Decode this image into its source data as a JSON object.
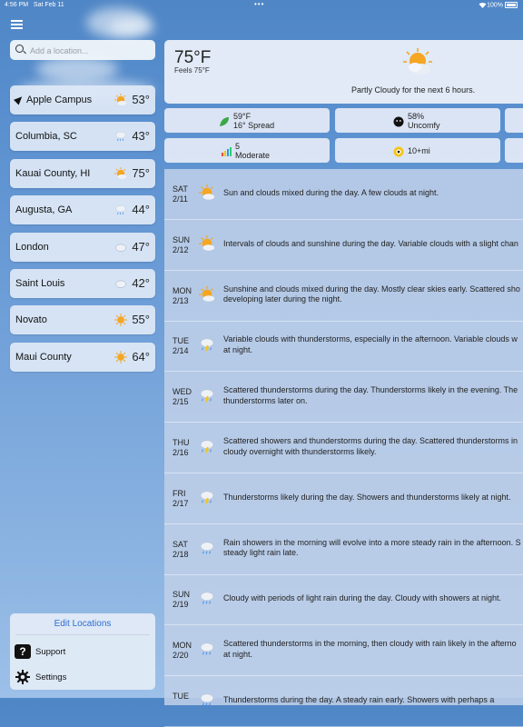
{
  "status_bar": {
    "time": "4:56 PM",
    "date": "Sat Feb 11",
    "battery": "100%"
  },
  "search": {
    "placeholder": "Add a location..."
  },
  "locations": [
    {
      "name": "Apple Campus",
      "temp": "53°",
      "icon": "partly-cloudy-icon",
      "active": true
    },
    {
      "name": "Columbia, SC",
      "temp": "43°",
      "icon": "rain-icon"
    },
    {
      "name": "Kauai County, HI",
      "temp": "75°",
      "icon": "partly-cloudy-icon"
    },
    {
      "name": "Augusta, GA",
      "temp": "44°",
      "icon": "rain-icon"
    },
    {
      "name": "London",
      "temp": "47°",
      "icon": "cloudy-icon"
    },
    {
      "name": "Saint Louis",
      "temp": "42°",
      "icon": "cloudy-icon"
    },
    {
      "name": "Novato",
      "temp": "55°",
      "icon": "sunny-icon"
    },
    {
      "name": "Maui County",
      "temp": "64°",
      "icon": "sunny-icon"
    }
  ],
  "bottom_panel": {
    "edit_locations": "Edit Locations",
    "support": "Support",
    "settings": "Settings"
  },
  "current": {
    "temp": "75°F",
    "feels_like": "Feels 75°F",
    "condition": "Partly Cloudy for the next 6 hours.",
    "icon": "partly-cloudy-icon"
  },
  "tiles": [
    {
      "icon": "leaf-icon",
      "line1": "59°F",
      "line2": "16° Spread"
    },
    {
      "icon": "dewpoint-face-icon",
      "line1": "58%",
      "line2": "Uncomfy"
    },
    {
      "icon": "uv-index-icon",
      "line1": "5",
      "line2": "Moderate"
    },
    {
      "icon": "visibility-eye-icon",
      "line1": "10+mi",
      "line2": ""
    }
  ],
  "forecast": [
    {
      "day": "SAT",
      "date": "2/11",
      "icon": "partly-cloudy-icon",
      "text": "Sun and clouds mixed during the day. A few clouds at night."
    },
    {
      "day": "SUN",
      "date": "2/12",
      "icon": "partly-cloudy-icon",
      "text": "Intervals of clouds and sunshine during the day. Variable clouds with a slight chan"
    },
    {
      "day": "MON",
      "date": "2/13",
      "icon": "partly-cloudy-icon",
      "text": "Sunshine and clouds mixed during the day. Mostly clear skies early. Scattered sho",
      "text2": "developing later during the night."
    },
    {
      "day": "TUE",
      "date": "2/14",
      "icon": "thunderstorm-icon",
      "text": "Variable clouds with thunderstorms, especially in the afternoon. Variable clouds w",
      "text2": "at night."
    },
    {
      "day": "WED",
      "date": "2/15",
      "icon": "thunderstorm-icon",
      "text": "Scattered thunderstorms during the day. Thunderstorms likely in the evening. The",
      "text2": "thunderstorms later on."
    },
    {
      "day": "THU",
      "date": "2/16",
      "icon": "thunderstorm-icon",
      "text": "Scattered showers and thunderstorms during the day. Scattered thunderstorms in",
      "text2": "cloudy overnight with thunderstorms likely."
    },
    {
      "day": "FRI",
      "date": "2/17",
      "icon": "thunderstorm-icon",
      "text": "Thunderstorms likely during the day. Showers and thunderstorms likely at night."
    },
    {
      "day": "SAT",
      "date": "2/18",
      "icon": "rain-icon",
      "text": "Rain showers in the morning will evolve into a more steady rain in the afternoon. S",
      "text2": "steady light rain late."
    },
    {
      "day": "SUN",
      "date": "2/19",
      "icon": "rain-icon",
      "text": "Cloudy with periods of light rain during the day. Cloudy with showers at night."
    },
    {
      "day": "MON",
      "date": "2/20",
      "icon": "rain-icon",
      "text": "Scattered thunderstorms in the morning, then cloudy with rain likely in the afterno",
      "text2": "at night."
    },
    {
      "day": "TUE",
      "date": "",
      "icon": "rain-icon",
      "text": "Thunderstorms during the day. A steady rain early. Showers with perhaps a"
    }
  ],
  "colors": {
    "accent": "#2a6fd1",
    "sun": "#f5a623",
    "sky": "#5a90cf"
  }
}
